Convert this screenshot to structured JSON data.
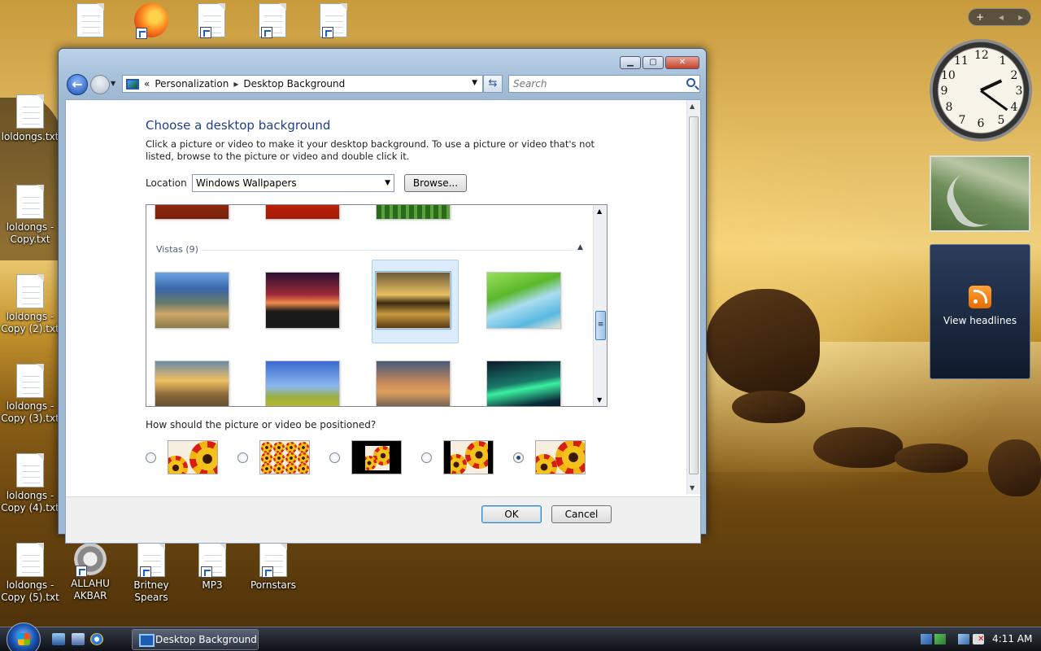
{
  "desktop": {
    "icons": [
      {
        "label": "",
        "type": "doc",
        "shortcut": false
      },
      {
        "label": "",
        "type": "firefox",
        "shortcut": true
      },
      {
        "label": "",
        "type": "doc",
        "shortcut": true
      },
      {
        "label": "",
        "type": "doc",
        "shortcut": true
      },
      {
        "label": "",
        "type": "doc",
        "shortcut": true
      },
      {
        "label": "loldongs.txt"
      },
      {
        "label": "loldongs - Copy.txt"
      },
      {
        "label": "loldongs - Copy (2).txt"
      },
      {
        "label": "loldongs - Copy (3).txt"
      },
      {
        "label": "loldongs - Copy (4).txt"
      },
      {
        "label": "loldongs - Copy (5).txt"
      },
      {
        "label": "ALLAHU AKBAR"
      },
      {
        "label": "Britney Spears"
      },
      {
        "label": "MP3"
      },
      {
        "label": "Pornstars"
      }
    ]
  },
  "gadgets": {
    "toolbar": {
      "add": "+",
      "prev": "◂",
      "next": "▸"
    },
    "clock": {
      "numbers": [
        "12",
        "1",
        "2",
        "3",
        "4",
        "5",
        "6",
        "7",
        "8",
        "9",
        "10",
        "11"
      ],
      "time": "4:11"
    },
    "feed": {
      "label": "View headlines",
      "icon": "rss-icon"
    }
  },
  "window": {
    "caption": {
      "minimize": "▁",
      "maximize": "▢",
      "close": "✕"
    },
    "address": {
      "segments": [
        "Personalization",
        "Desktop Background"
      ],
      "prefix": "«",
      "separator": "▸"
    },
    "search_placeholder": "Search",
    "heading": "Choose a desktop background",
    "description": "Click a picture or video to make it your desktop background. To use a picture or video that's not listed, browse to the picture or video and double click it.",
    "location_label": "Location",
    "location_value": "Windows Wallpapers",
    "browse_label": "Browse...",
    "group_label": "Vistas (9)",
    "position_label": "How should the picture or video be positioned?",
    "position_options": [
      "fill",
      "tile",
      "center",
      "fit",
      "stretch"
    ],
    "position_selected": 4,
    "ok_label": "OK",
    "cancel_label": "Cancel",
    "gallery_selected": 2
  },
  "taskbar": {
    "task_label": "Desktop Background",
    "time": "4:11 AM"
  }
}
